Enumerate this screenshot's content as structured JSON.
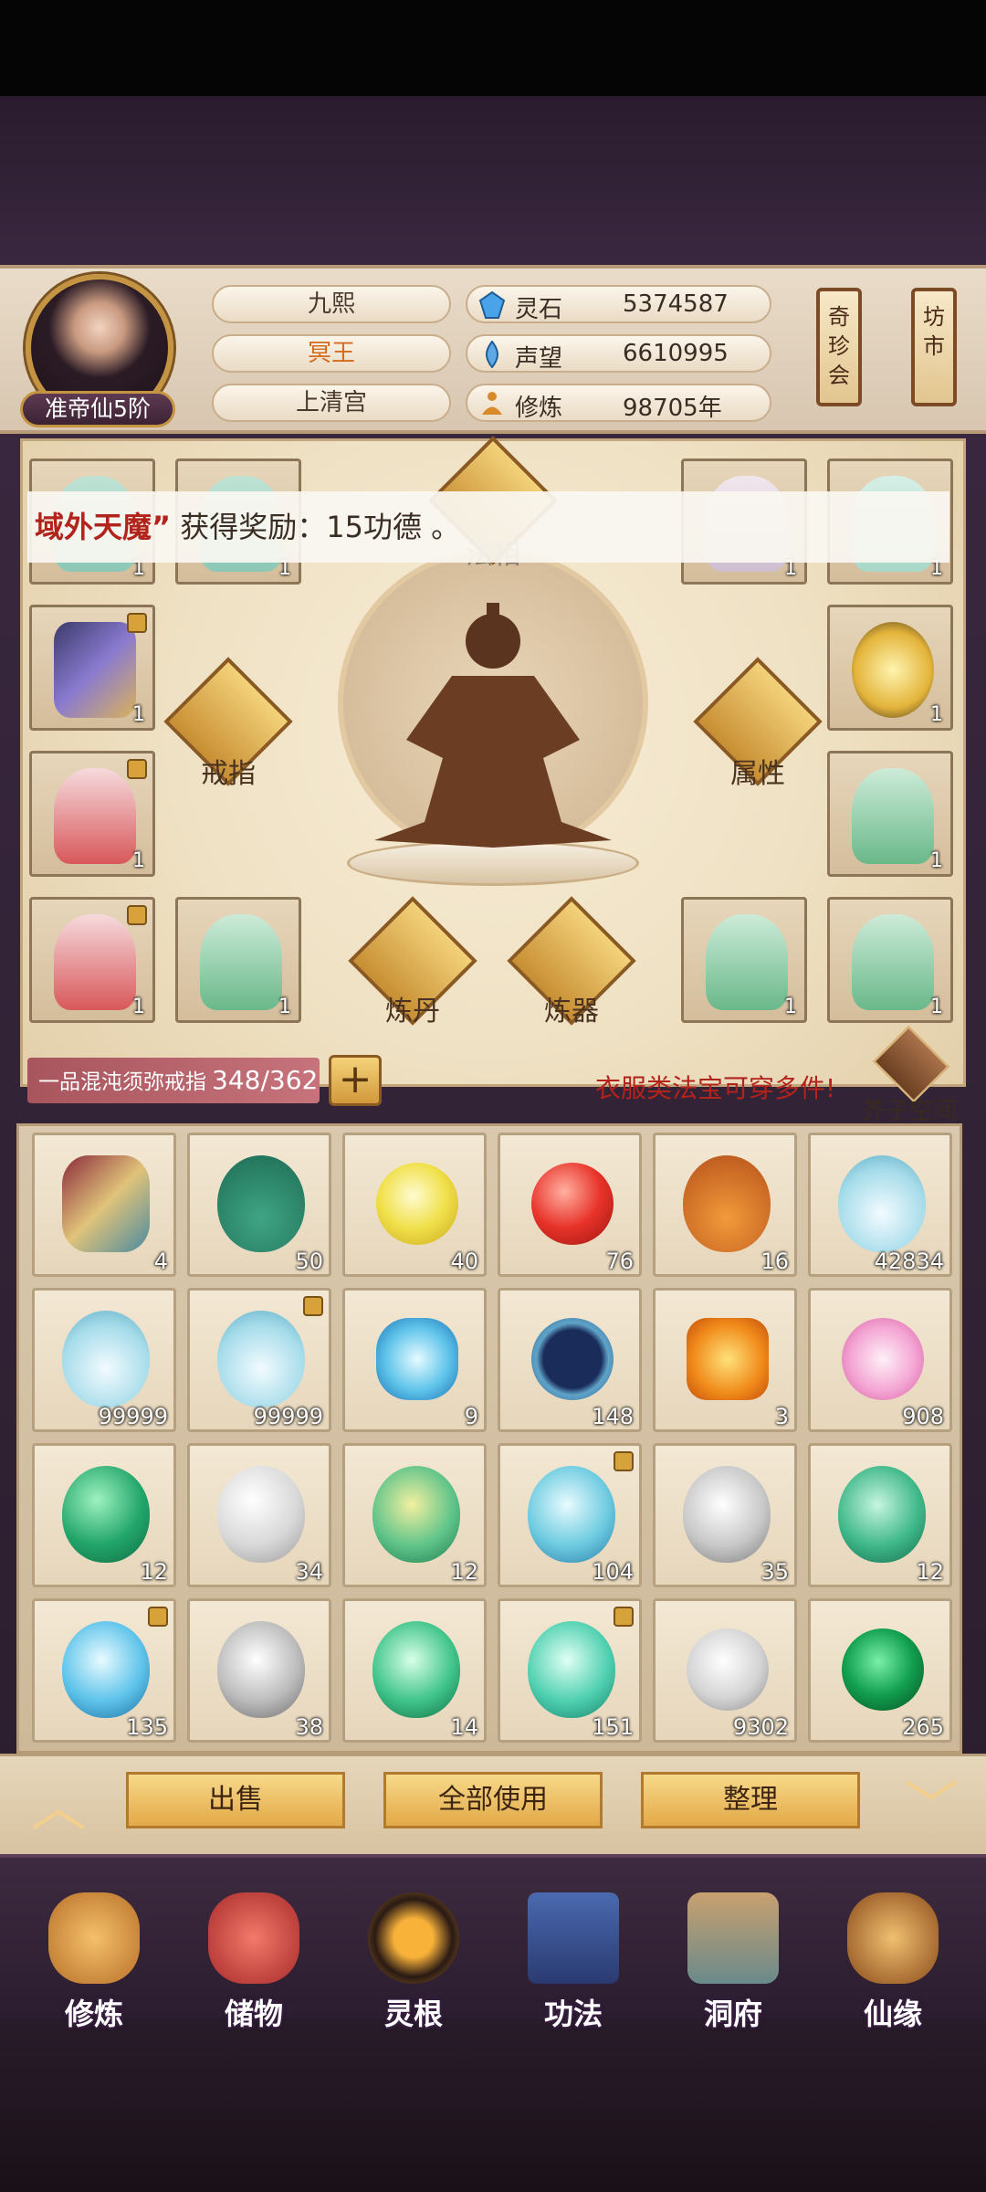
{
  "player": {
    "rank": "准帝仙5阶",
    "name": "九熙",
    "title": "冥王",
    "sect": "上清宫"
  },
  "resources": [
    {
      "label": "灵石",
      "value": "5374587",
      "icon": "spirit-stone-icon"
    },
    {
      "label": "声望",
      "value": "6610995",
      "icon": "prestige-icon"
    },
    {
      "label": "修炼",
      "value": "98705年",
      "icon": "meditation-icon"
    }
  ],
  "scrolls": {
    "left": "奇珍会",
    "right": "坊市"
  },
  "notice": {
    "highlight": "域外天魔”",
    "text": " 获得奖励：15功德 。"
  },
  "equip": {
    "slots_top_left": [
      "1",
      "1"
    ],
    "slots_top_right": [
      "1",
      "1"
    ],
    "slots_row2": [
      "1",
      "1"
    ],
    "slots_row3": [
      "1",
      "1"
    ],
    "slots_row4_left": [
      "1",
      "1"
    ],
    "slots_row4_right": [
      "1",
      "1"
    ],
    "faxiang": "法相",
    "ring": "戒指",
    "attr": "属性",
    "alchemy": "炼丹",
    "forge": "炼器"
  },
  "ring_bar": {
    "name": "一品混沌须弥戒指",
    "capacity": "348/362"
  },
  "hint": "衣服类法宝可穿多件!",
  "mustard_space": "芥子空间",
  "inventory": [
    [
      "4",
      "50",
      "40",
      "76",
      "16",
      "42834"
    ],
    [
      "99999",
      "99999",
      "9",
      "148",
      "3",
      "908"
    ],
    [
      "12",
      "34",
      "12",
      "104",
      "35",
      "12"
    ],
    [
      "135",
      "38",
      "14",
      "151",
      "9302",
      "265"
    ]
  ],
  "buttons": {
    "sell": "出售",
    "use_all": "全部使用",
    "sort": "整理"
  },
  "nav": [
    "修炼",
    "储物",
    "灵根",
    "功法",
    "洞府",
    "仙缘"
  ],
  "colors": {
    "accent_red": "#b2231c",
    "gold": "#e3a948"
  }
}
